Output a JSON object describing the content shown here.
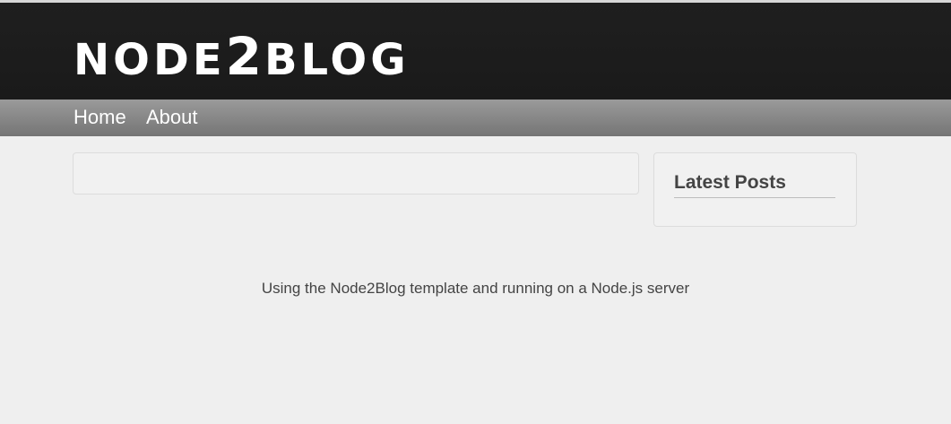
{
  "header": {
    "logo_part1": "node",
    "logo_part2": "2",
    "logo_part3": "blog",
    "background_color": "#1a1a1a"
  },
  "nav": {
    "items": [
      {
        "label": "Home"
      },
      {
        "label": "About"
      }
    ],
    "background_color": "#8a8a8a"
  },
  "sidebar": {
    "title": "Latest Posts"
  },
  "footer": {
    "text": "Using the Node2Blog template and running on a Node.js server"
  }
}
